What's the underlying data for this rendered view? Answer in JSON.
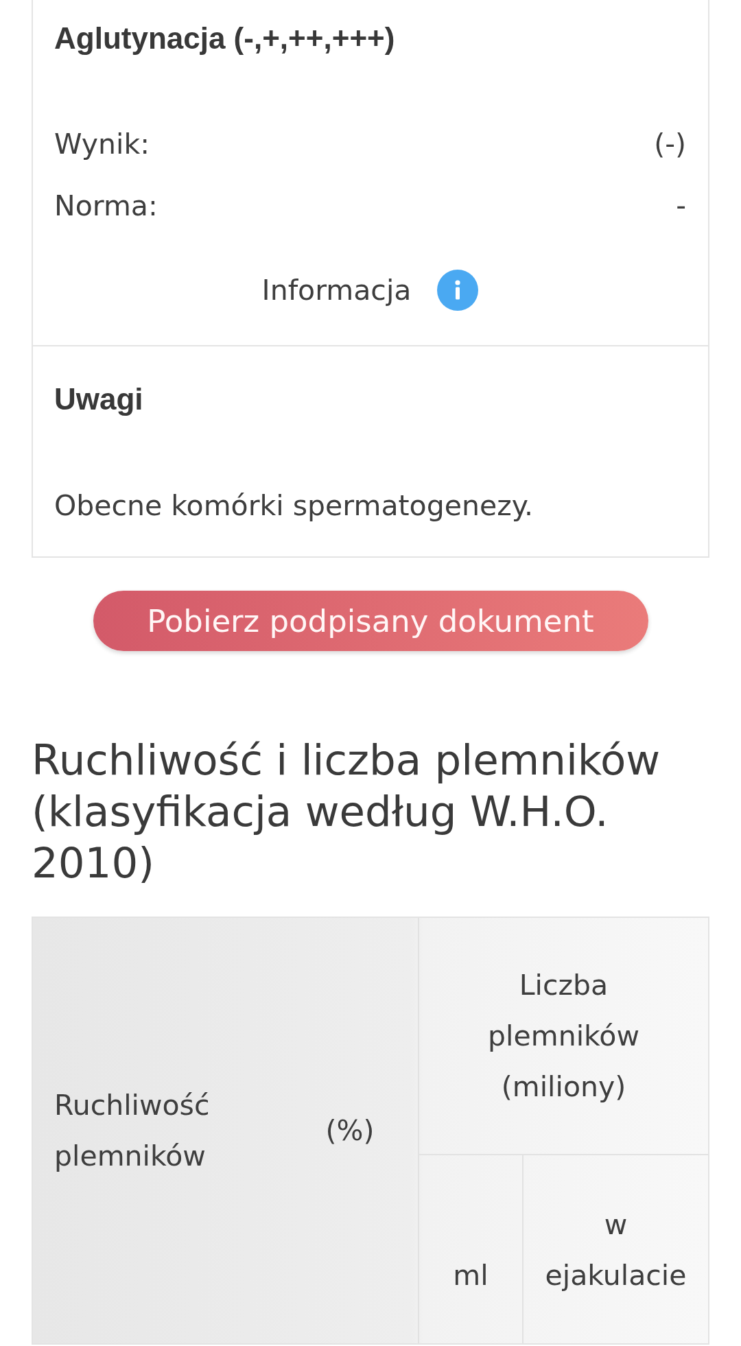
{
  "sections": [
    {
      "kind": "result",
      "title": "Aglutynacja (-,+,++,+++)",
      "rows": [
        {
          "label": "Wynik:",
          "value": "(-)"
        },
        {
          "label": "Norma:",
          "value": "-"
        }
      ],
      "info_link": "Informacja"
    },
    {
      "kind": "note",
      "title": "Uwagi",
      "text": "Obecne komórki spermatogenezy."
    }
  ],
  "download_button": "Pobierz podpisany dokument",
  "motility_section": {
    "heading": "Ruchliwość i liczba plemników (klasyfikacja według W.H.O. 2010)",
    "table": {
      "columns": [
        {
          "label": "Ruchliwość plemników"
        },
        {
          "label": "(%)"
        },
        {
          "label": "Liczba plemników (miliony)",
          "children": [
            {
              "label": "ml"
            },
            {
              "label": "w ejakulacie"
            }
          ]
        }
      ]
    }
  }
}
